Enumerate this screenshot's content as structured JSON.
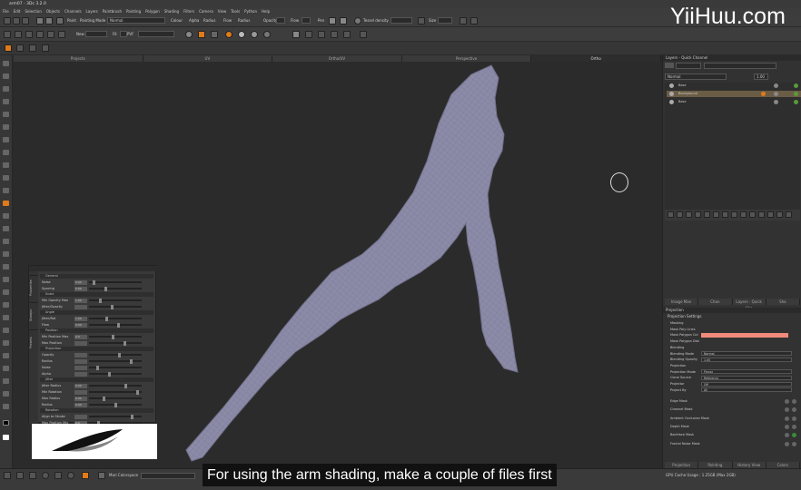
{
  "window": {
    "title": "arm07 - 3Dc 3.2.0"
  },
  "menu": [
    "File",
    "Edit",
    "Selection",
    "Objects",
    "Channels",
    "Layers",
    "Paintbrush",
    "Painting",
    "Polygon",
    "Shading",
    "Filters",
    "Camera",
    "View",
    "Tools",
    "Python",
    "Help"
  ],
  "toolbar": {
    "paint_label": "Paint",
    "painting_mode_label": "Painting Mode",
    "painting_mode_value": "Normal",
    "colour_label": "Colour",
    "alpha_label": "Alpha",
    "radius_label": "Radius",
    "flow_label": "Flow",
    "opacity_label": "Opacity",
    "opacity_value": "100",
    "pen_label": "Pen",
    "tessellate_label": "Tessel density",
    "size_label": "Size",
    "new_label": "New",
    "fit_label": "Fit",
    "pv_label": "PVF"
  },
  "viewport_tabs": [
    "Projects",
    "UV",
    "Ortho/UV",
    "Perspective",
    "Ortho"
  ],
  "viewport_active_tab": "Ortho",
  "layers_panel": {
    "title": "Layers - Quick Channel",
    "mode_value": "Normal",
    "opacity_value": "1.00",
    "layers": [
      {
        "name": "Base"
      },
      {
        "name": "Background"
      },
      {
        "name": "Base"
      }
    ],
    "tabs": [
      "Image Man",
      "Chan",
      "Layers - Quick Cha",
      "Sha"
    ]
  },
  "projection_panel": {
    "title": "Projection",
    "header": "Projection Settings",
    "rows": [
      {
        "label": "Masking"
      },
      {
        "label": "Mask Poly Lines"
      },
      {
        "label": "Mask Polygon Col"
      },
      {
        "label": "Mask Polygon Dist"
      },
      {
        "label": "Blending"
      },
      {
        "label": "Blending Mode",
        "value": "Normal"
      },
      {
        "label": "Blending Opacity",
        "value": "1.00"
      },
      {
        "label": "Projection"
      },
      {
        "label": "Projection Mode",
        "value": "Planar"
      },
      {
        "label": "Clone Source",
        "value": "Reference"
      },
      {
        "label": "Projector",
        "value": "Off"
      },
      {
        "label": "Project By",
        "value": "All"
      }
    ],
    "masks": [
      "Edge Mask",
      "Channel Mask",
      "Ambient Occlusion Mask",
      "Depth Mask",
      "Backface Mask",
      "Fractal Noise Mask"
    ],
    "bottom_tabs": [
      "Projection",
      "Painting",
      "History View",
      "Colors"
    ]
  },
  "paint_panel": {
    "side_tabs": [
      "Properties",
      "Stamps",
      "Presets"
    ],
    "sections": [
      {
        "name": "General",
        "rows": [
          {
            "label": "Noise",
            "value": "0.00"
          },
          {
            "label": "Spacing",
            "value": "0.00"
          }
        ]
      },
      {
        "name": "Scale",
        "rows": [
          {
            "label": "Min Opacity Max",
            "value": "1.00"
          },
          {
            "label": "Jitter/Opacity",
            "value": ""
          }
        ]
      },
      {
        "name": "Angle",
        "rows": [
          {
            "label": "Jitter/Rot",
            "value": "1.00"
          },
          {
            "label": "Flow",
            "value": "0.00"
          }
        ]
      },
      {
        "name": "Position",
        "rows": [
          {
            "label": "Min Position Max",
            "value": "0.0"
          },
          {
            "label": "Max Position",
            "value": ""
          }
        ]
      },
      {
        "name": "Projection",
        "rows": [
          {
            "label": "Opacity",
            "value": ""
          },
          {
            "label": "Radius",
            "value": ""
          },
          {
            "label": "Noise",
            "value": ""
          },
          {
            "label": "Alpha",
            "value": ""
          }
        ]
      },
      {
        "name": "Jitter",
        "rows": [
          {
            "label": "Jitter Radius",
            "value": "0.00"
          },
          {
            "label": "Min Rotation",
            "value": ""
          },
          {
            "label": "Max Radius",
            "value": "0.00"
          },
          {
            "label": "Radius",
            "value": "0.00"
          }
        ]
      },
      {
        "name": "Rotation",
        "rows": [
          {
            "label": "Align to Stroke",
            "value": ""
          },
          {
            "label": "Max Position Mix",
            "value": "0.0"
          }
        ]
      }
    ]
  },
  "statusbar": {
    "colourspace": "Mari Colorspace",
    "memory": "GPU Cache Usage : 1.25GB (Max 2GB)"
  },
  "subtitle": "For using the arm shading, make a couple of files first",
  "watermark": "YiiHuu.com",
  "colors": {
    "mesh_fill": "#8a8aa6",
    "accent_orange": "#e07a1a",
    "selected_layer": "#6b5d45",
    "mask_col": "#f08a7a"
  }
}
